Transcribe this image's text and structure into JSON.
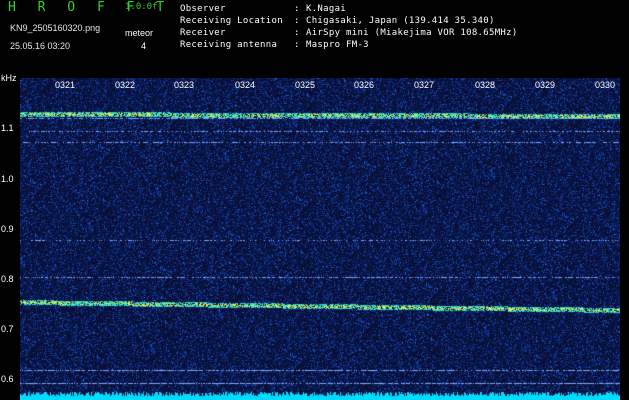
{
  "header": {
    "app_name": "H R O F F T",
    "version": "1.0.0f",
    "filename": "KN9_2505160320.png",
    "datetime": "25.05.16 03:20",
    "meteor_label": "meteor",
    "meteor_count": "4"
  },
  "info": [
    {
      "key": "Observer",
      "sep": ":",
      "value": "K.Nagai"
    },
    {
      "key": "Receiving Location",
      "sep": ":",
      "value": "Chigasaki, Japan (139.414 35.340)"
    },
    {
      "key": "Receiver",
      "sep": ":",
      "value": "AirSpy mini (Miakejima VOR 108.65MHz)"
    },
    {
      "key": "Receiving antenna",
      "sep": ":",
      "value": "Maspro FM-3"
    }
  ],
  "axis": {
    "y_unit": "kHz",
    "y_ticks": [
      "1.1",
      "1.0",
      "0.9",
      "0.8",
      "0.7",
      "0.6"
    ],
    "x_ticks": [
      "0321",
      "0322",
      "0323",
      "0324",
      "0325",
      "0326",
      "0327",
      "0328",
      "0329",
      "0330"
    ]
  },
  "colors": {
    "logo": "#2ed12e",
    "background": "#0a0f2e",
    "signal": "#ffee44",
    "noise_floor": "#00e5ff"
  }
}
